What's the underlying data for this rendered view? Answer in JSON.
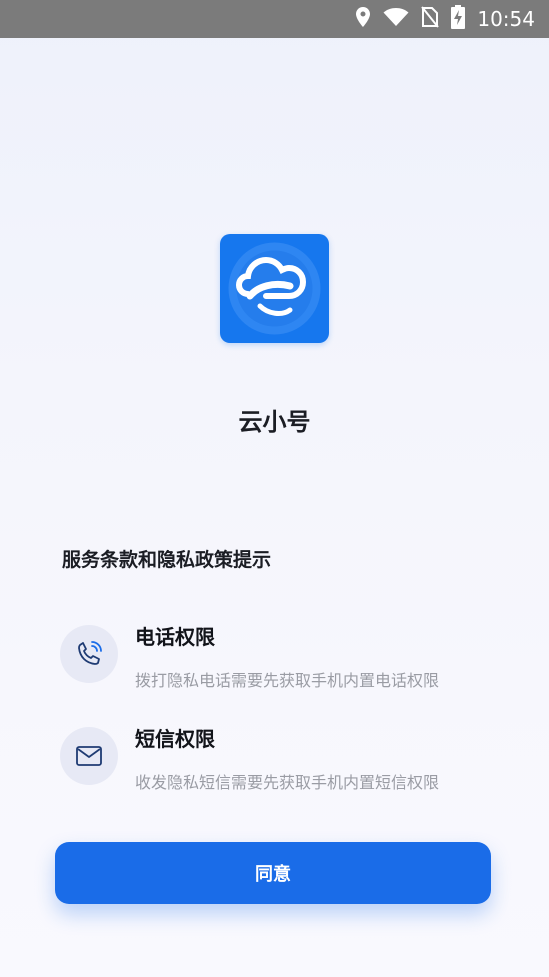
{
  "status_bar": {
    "time": "10:54",
    "icons": [
      "location-icon",
      "wifi-icon",
      "no-sim-icon",
      "battery-charging-icon"
    ]
  },
  "app": {
    "icon": "cloud-app-icon",
    "name": "云小号"
  },
  "notice": {
    "title": "服务条款和隐私政策提示"
  },
  "permissions": [
    {
      "icon": "phone-icon",
      "title": "电话权限",
      "description": "拨打隐私电话需要先获取手机内置电话权限"
    },
    {
      "icon": "mail-icon",
      "title": "短信权限",
      "description": "收发隐私短信需要先获取手机内置短信权限"
    }
  ],
  "actions": {
    "agree_label": "同意"
  },
  "colors": {
    "accent": "#1a6ce8",
    "app_icon_bg": "#1677ee",
    "status_bar_bg": "#7b7b7b",
    "icon_circle_bg": "#e7e9f5",
    "description_text": "#9a9ca4"
  }
}
